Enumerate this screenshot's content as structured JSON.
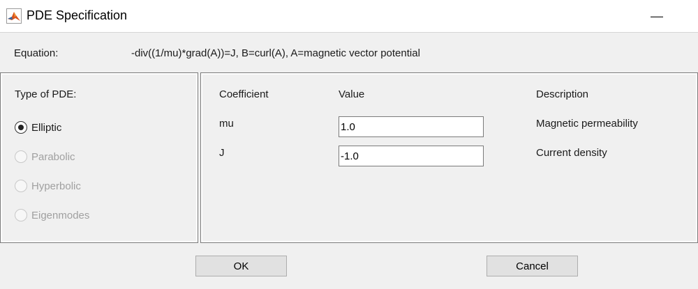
{
  "window": {
    "title": "PDE Specification",
    "minimize_symbol": "—",
    "icon": "matlab-logo-icon"
  },
  "equation": {
    "label": "Equation:",
    "value": "-div((1/mu)*grad(A))=J, B=curl(A), A=magnetic vector potential"
  },
  "pde_type": {
    "label": "Type of PDE:",
    "options": [
      {
        "label": "Elliptic",
        "selected": true,
        "enabled": true
      },
      {
        "label": "Parabolic",
        "selected": false,
        "enabled": false
      },
      {
        "label": "Hyperbolic",
        "selected": false,
        "enabled": false
      },
      {
        "label": "Eigenmodes",
        "selected": false,
        "enabled": false
      }
    ]
  },
  "coefficients": {
    "headers": {
      "coefficient": "Coefficient",
      "value": "Value",
      "description": "Description"
    },
    "rows": [
      {
        "name": "mu",
        "value": "1.0",
        "description": "Magnetic permeability"
      },
      {
        "name": "J",
        "value": "-1.0",
        "description": "Current density"
      }
    ]
  },
  "buttons": {
    "ok": "OK",
    "cancel": "Cancel"
  },
  "colors": {
    "background": "#f0f0f0",
    "titlebar": "#ffffff",
    "disabled_text": "#a0a0a0"
  }
}
